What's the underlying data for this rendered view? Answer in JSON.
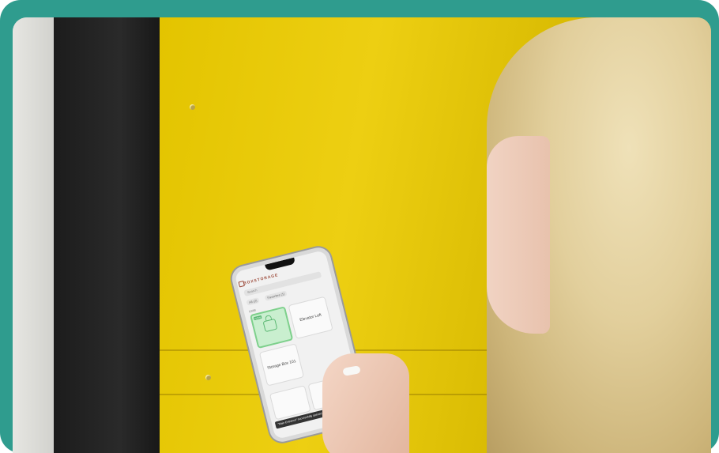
{
  "photo": {
    "subject": "person-using-phone-at-storage-locker",
    "accent_color": "#2f9c8e",
    "locker_color": "#e8c800"
  },
  "phone_screen": {
    "brand": "BOXSTORAGE",
    "search_placeholder": "Search",
    "chips": [
      "All (2)",
      "Favorites (1)"
    ],
    "section_label": "Units",
    "tiles": [
      {
        "label": "",
        "state": "unlocked",
        "badge": "Active"
      },
      {
        "label": "Elevator Left"
      },
      {
        "label": "Storage Box 101"
      }
    ],
    "toast": "\"Main Entrance\" successfully opened"
  }
}
